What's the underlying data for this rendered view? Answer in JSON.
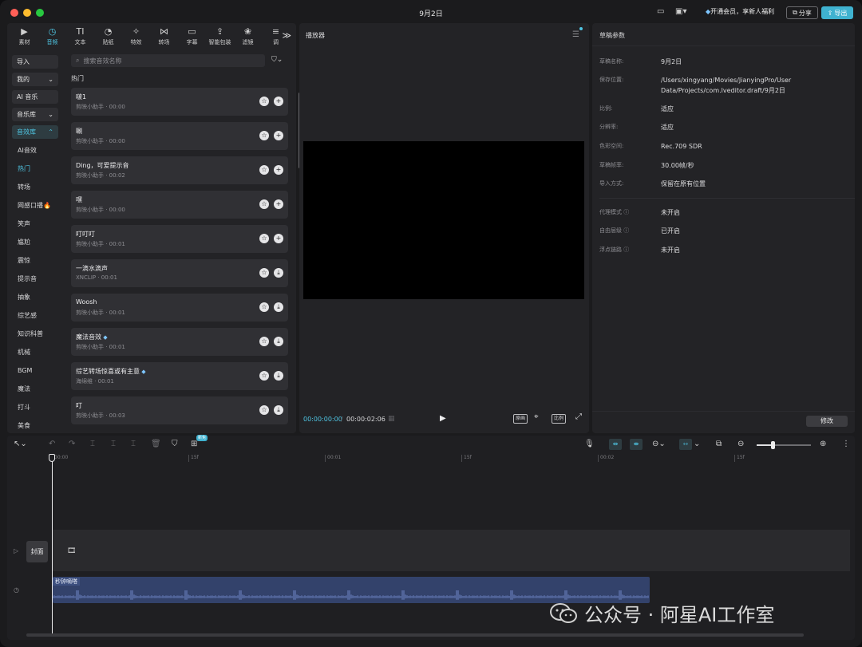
{
  "window": {
    "title": "9月2日"
  },
  "titlebar": {
    "vip_text": "开通会员，享新人福利",
    "share_label": "分享",
    "export_label": "导出"
  },
  "media_tabs": [
    {
      "label": "素材",
      "icon": "media-icon",
      "glyph": "▶"
    },
    {
      "label": "音频",
      "icon": "audio-icon",
      "glyph": "◷",
      "active": true
    },
    {
      "label": "文本",
      "icon": "text-icon",
      "glyph": "TI"
    },
    {
      "label": "贴纸",
      "icon": "sticker-icon",
      "glyph": "◔"
    },
    {
      "label": "特效",
      "icon": "effects-icon",
      "glyph": "✧"
    },
    {
      "label": "转场",
      "icon": "transition-icon",
      "glyph": "⋈"
    },
    {
      "label": "字幕",
      "icon": "subtitle-icon",
      "glyph": "▭"
    },
    {
      "label": "智能包装",
      "icon": "smart-pack-icon",
      "glyph": "⇪"
    },
    {
      "label": "滤镜",
      "icon": "filter-icon",
      "glyph": "❀"
    },
    {
      "label": "调",
      "icon": "adjust-icon",
      "glyph": "≡"
    }
  ],
  "categories": {
    "import_label": "导入",
    "mine_label": "我的",
    "ai_music_label": "AI 音乐",
    "music_lib_label": "音乐库",
    "sfx_lib_label": "音效库",
    "items": [
      "AI音效",
      "热门",
      "转场",
      "网感口播🔥",
      "笑声",
      "尴尬",
      "震惊",
      "提示音",
      "抽象",
      "综艺感",
      "知识科普",
      "机械",
      "BGM",
      "魔法",
      "打斗",
      "美食"
    ],
    "active_item": "热门"
  },
  "search": {
    "placeholder": "搜索音效名称"
  },
  "section_title": "热门",
  "sounds": [
    {
      "name": "啵1",
      "meta": "剪映小助手 · 00:00",
      "action": "add"
    },
    {
      "name": "唰",
      "meta": "剪映小助手 · 00:00",
      "action": "add"
    },
    {
      "name": "Ding，可爱提示音",
      "meta": "剪映小助手 · 00:02",
      "action": "add"
    },
    {
      "name": "嘿",
      "meta": "剪映小助手 · 00:00",
      "action": "add"
    },
    {
      "name": "叮叮叮",
      "meta": "剪映小助手 · 00:01",
      "action": "add"
    },
    {
      "name": "一滴水滴声",
      "meta": "XNCLIP · 00:01",
      "action": "download"
    },
    {
      "name": "Woosh",
      "meta": "剪映小助手 · 00:01",
      "action": "download"
    },
    {
      "name": "魔法音效",
      "meta": "剪映小助手 · 00:01",
      "action": "download",
      "vip": true
    },
    {
      "name": "综艺转场惊喜或有主意",
      "meta": "海绵维 · 00:01",
      "action": "download",
      "vip": true
    },
    {
      "name": "叮",
      "meta": "剪映小助手 · 00:03",
      "action": "download"
    }
  ],
  "player": {
    "title": "播放器",
    "time_current": "00:00:00:00",
    "time_total": "00:00:02:06",
    "ctrl_fill": "原画",
    "ctrl_ratio": "比例"
  },
  "draft": {
    "title": "草稿参数",
    "rows": [
      {
        "label": "草稿名称:",
        "value": "9月2日"
      },
      {
        "label": "保存位置:",
        "value": "/Users/xingyang/Movies/JianyingPro/User Data/Projects/com.lveditor.draft/9月2日"
      },
      {
        "label": "比例:",
        "value": "适应"
      },
      {
        "label": "分辨率:",
        "value": "适应"
      },
      {
        "label": "色彩空间:",
        "value": "Rec.709 SDR"
      },
      {
        "label": "草稿帧率:",
        "value": "30.00帧/秒"
      },
      {
        "label": "导入方式:",
        "value": "保留在原有位置"
      }
    ],
    "rows2": [
      {
        "label": "代理模式",
        "value": "未开启"
      },
      {
        "label": "自由层级",
        "value": "已开启"
      },
      {
        "label": "浮点链路",
        "value": "未开启"
      }
    ],
    "edit_label": "修改"
  },
  "timeline": {
    "new_badge": "新免",
    "ruler": [
      "00:00",
      "15f",
      "00:01",
      "15f",
      "00:02",
      "15f"
    ],
    "cover_label": "封面",
    "audio_clip_label": "秒钟嘀嗒",
    "zoom_fraction": 0.3
  },
  "watermark": {
    "text": "公众号 · 阿星AI工作室"
  },
  "colors": {
    "accent": "#4fc6e4",
    "export_bg": "#3fb2d0",
    "audio_clip": "#33426b"
  }
}
